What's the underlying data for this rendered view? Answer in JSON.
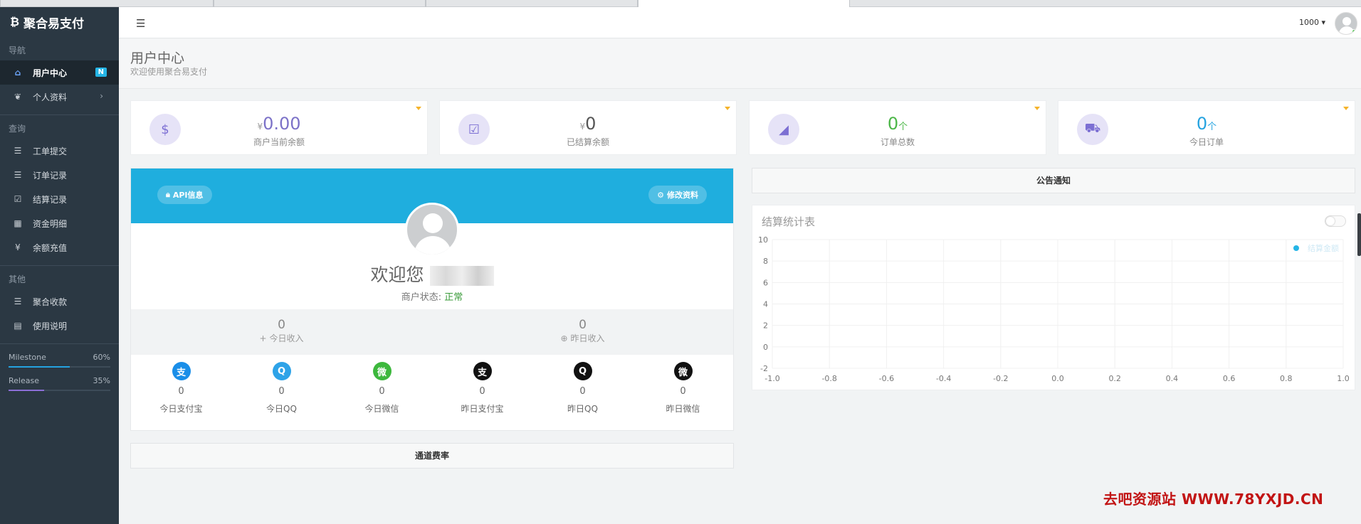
{
  "brand": {
    "title": "聚合易支付",
    "icon": "bitcoin-icon"
  },
  "sidebar": {
    "sections": [
      {
        "title": "导航",
        "items": [
          {
            "label": "用户中心",
            "icon": "home-icon",
            "badge": "N",
            "active": true
          },
          {
            "label": "个人资料",
            "icon": "leaf-icon",
            "chevron": "›"
          }
        ]
      },
      {
        "title": "查询",
        "items": [
          {
            "label": "工单提交",
            "icon": "list-icon"
          },
          {
            "label": "订单记录",
            "icon": "list-icon"
          },
          {
            "label": "结算记录",
            "icon": "check-square-icon"
          },
          {
            "label": "资金明细",
            "icon": "calendar-icon"
          },
          {
            "label": "余额充值",
            "icon": "yen-icon"
          }
        ]
      },
      {
        "title": "其他",
        "items": [
          {
            "label": "聚合收款",
            "icon": "list-icon"
          },
          {
            "label": "使用说明",
            "icon": "book-icon"
          }
        ]
      }
    ],
    "progress": [
      {
        "label": "Milestone",
        "pct_text": "60%",
        "value": 0.6,
        "color": "#25a3e0"
      },
      {
        "label": "Release",
        "pct_text": "35%",
        "value": 0.35,
        "color": "#8b6fd6"
      }
    ]
  },
  "topbar": {
    "menu_icon": "menu-icon",
    "user": "1000",
    "caret": "▾"
  },
  "header": {
    "title": "用户中心",
    "subtitle": "欢迎使用聚合易支付"
  },
  "stats": [
    {
      "currency": "¥",
      "value": "0.00",
      "unit": "",
      "label": "商户当前余额",
      "icon": "money-icon",
      "color": "#7c72c8"
    },
    {
      "currency": "¥",
      "value": "0",
      "unit": "",
      "label": "已结算余额",
      "icon": "check-square-icon",
      "color": "#555555"
    },
    {
      "currency": "",
      "value": "0",
      "unit": "个",
      "label": "订单总数",
      "icon": "area-chart-icon",
      "color": "#4cb748"
    },
    {
      "currency": "",
      "value": "0",
      "unit": "个",
      "label": "今日订单",
      "icon": "cart-icon",
      "color": "#25a3e0"
    }
  ],
  "profile": {
    "api_btn": "API信息",
    "edit_btn": "修改资料",
    "welcome": "欢迎您",
    "status_label": "商户状态:",
    "status_value": "正常",
    "today_income": {
      "value": "0",
      "label": "今日收入",
      "icon": "+"
    },
    "yesterday_income": {
      "value": "0",
      "label": "昨日收入",
      "icon": "⊕"
    },
    "payments": [
      {
        "value": "0",
        "label": "今日支付宝",
        "icon": "alipay-icon",
        "glyph": "支",
        "color": "#1a8ee8"
      },
      {
        "value": "0",
        "label": "今日QQ",
        "icon": "qq-icon",
        "glyph": "Q",
        "color": "#2ea3e8"
      },
      {
        "value": "0",
        "label": "今日微信",
        "icon": "wechat-icon",
        "glyph": "微",
        "color": "#3db83d"
      },
      {
        "value": "0",
        "label": "昨日支付宝",
        "icon": "alipay-icon",
        "glyph": "支",
        "color": "#111111"
      },
      {
        "value": "0",
        "label": "昨日QQ",
        "icon": "qq-icon",
        "glyph": "Q",
        "color": "#111111"
      },
      {
        "value": "0",
        "label": "昨日微信",
        "icon": "wechat-icon",
        "glyph": "微",
        "color": "#111111"
      }
    ]
  },
  "channel_title": "通道费率",
  "notice_title": "公告通知",
  "chart_data": {
    "type": "line",
    "title": "结算统计表",
    "series": [
      {
        "name": "结算金额",
        "values": [],
        "color": "#25b5e6"
      }
    ],
    "x_ticks": [
      "-1.0",
      "-0.8",
      "-0.6",
      "-0.4",
      "-0.2",
      "0.0",
      "0.2",
      "0.4",
      "0.6",
      "0.8",
      "1.0"
    ],
    "y_ticks": [
      "-2",
      "0",
      "2",
      "4",
      "6",
      "8",
      "10"
    ],
    "xlim": [
      -1.0,
      1.0
    ],
    "ylim": [
      -2,
      10
    ],
    "grid": true,
    "legend": "top-right"
  },
  "watermark": "去吧资源站 WWW.78YXJD.CN"
}
